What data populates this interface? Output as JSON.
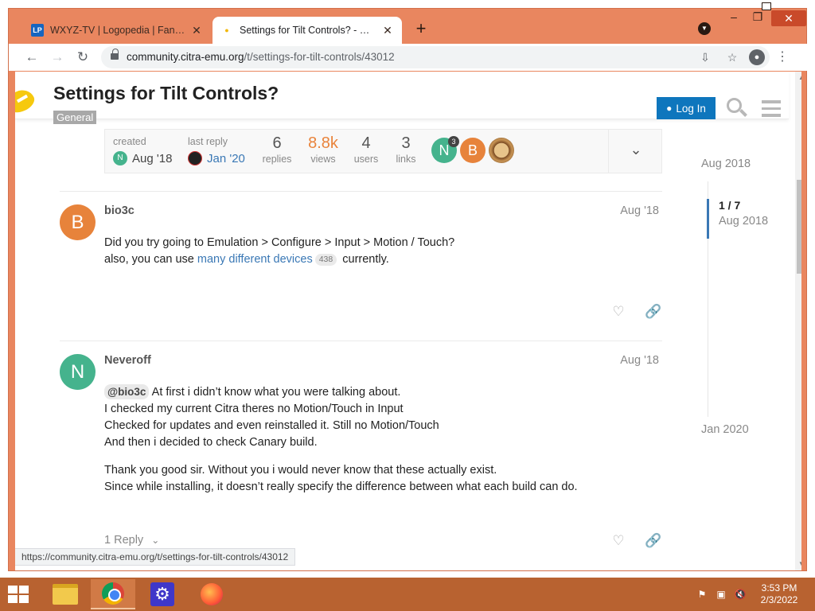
{
  "browser": {
    "tabs": [
      {
        "title": "WXYZ-TV | Logopedia | Fandom",
        "favicon": "LP"
      },
      {
        "title": "Settings for Tilt Controls? - General",
        "favicon": "citra-lemon"
      }
    ],
    "url_host": "community.citra-emu.org",
    "url_path": "/t/settings-for-tilt-controls/43012",
    "status_url": "https://community.citra-emu.org/t/settings-for-tilt-controls/43012"
  },
  "site": {
    "title": "Settings for Tilt Controls?",
    "category": "General",
    "login_label": "Log In"
  },
  "topic_map": {
    "created_label": "created",
    "created_date": "Aug '18",
    "created_avatar_letter": "N",
    "last_reply_label": "last reply",
    "last_reply_date": "Jan '20",
    "stats": [
      {
        "value": "6",
        "label": "replies"
      },
      {
        "value": "8.8k",
        "label": "views"
      },
      {
        "value": "4",
        "label": "users"
      },
      {
        "value": "3",
        "label": "links"
      }
    ],
    "participants": [
      {
        "letter": "N",
        "color": "#45b38d",
        "count": "3"
      },
      {
        "letter": "B",
        "color": "#e7833b",
        "count": ""
      },
      {
        "letter": "",
        "color": "#9a6a3a",
        "count": ""
      }
    ]
  },
  "posts": [
    {
      "username": "bio3c",
      "date": "Aug '18",
      "avatar_letter": "B",
      "avatar_color": "#e7833b",
      "line1": "Did you try going to Emulation > Configure > Input > Motion / Touch?",
      "line2_pre": "also, you can use",
      "link_text": "many different devices",
      "link_clicks": "438",
      "line2_post": "currently."
    },
    {
      "username": "Neveroff",
      "date": "Aug '18",
      "avatar_letter": "N",
      "avatar_color": "#45b38d",
      "mention": "@bio3c",
      "line1": "At first i didn’t know what you were talking about.",
      "line2": "I checked my current Citra theres no Motion/Touch in Input",
      "line3": "Checked for updates and even reinstalled it. Still no Motion/Touch",
      "line4": "And then i decided to check Canary build.",
      "line5": "Thank you good sir. Without you i would never know that these actually exist.",
      "line6": "Since while installing, it doesn’t really specify the difference between what each build can do.",
      "replies": "1 Reply"
    }
  ],
  "timeline": {
    "start": "Aug 2018",
    "position": "1 / 7",
    "position_date": "Aug 2018",
    "end": "Jan 2020"
  },
  "taskbar": {
    "time": "3:53 PM",
    "date": "2/3/2022"
  }
}
